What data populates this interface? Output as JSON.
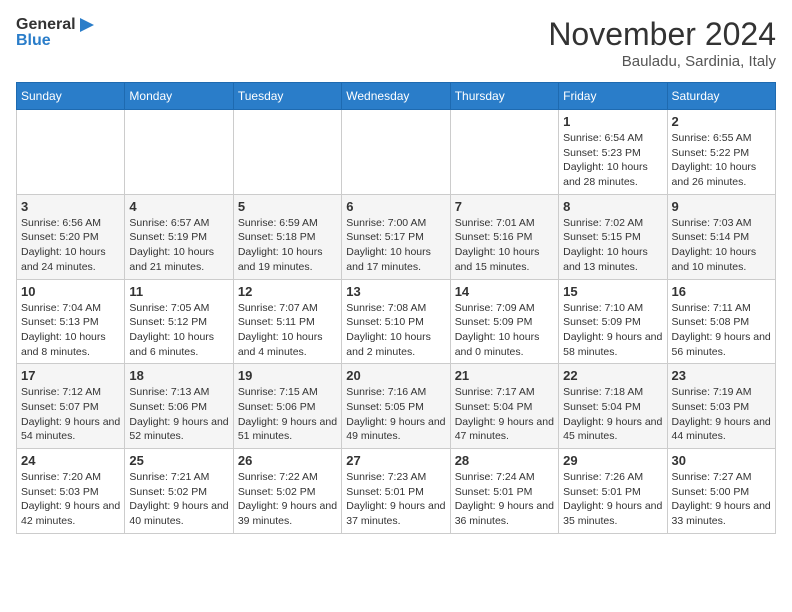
{
  "header": {
    "logo_general": "General",
    "logo_blue": "Blue",
    "month_title": "November 2024",
    "location": "Bauladu, Sardinia, Italy"
  },
  "weekdays": [
    "Sunday",
    "Monday",
    "Tuesday",
    "Wednesday",
    "Thursday",
    "Friday",
    "Saturday"
  ],
  "weeks": [
    [
      {
        "day": "",
        "info": ""
      },
      {
        "day": "",
        "info": ""
      },
      {
        "day": "",
        "info": ""
      },
      {
        "day": "",
        "info": ""
      },
      {
        "day": "",
        "info": ""
      },
      {
        "day": "1",
        "info": "Sunrise: 6:54 AM\nSunset: 5:23 PM\nDaylight: 10 hours and 28 minutes."
      },
      {
        "day": "2",
        "info": "Sunrise: 6:55 AM\nSunset: 5:22 PM\nDaylight: 10 hours and 26 minutes."
      }
    ],
    [
      {
        "day": "3",
        "info": "Sunrise: 6:56 AM\nSunset: 5:20 PM\nDaylight: 10 hours and 24 minutes."
      },
      {
        "day": "4",
        "info": "Sunrise: 6:57 AM\nSunset: 5:19 PM\nDaylight: 10 hours and 21 minutes."
      },
      {
        "day": "5",
        "info": "Sunrise: 6:59 AM\nSunset: 5:18 PM\nDaylight: 10 hours and 19 minutes."
      },
      {
        "day": "6",
        "info": "Sunrise: 7:00 AM\nSunset: 5:17 PM\nDaylight: 10 hours and 17 minutes."
      },
      {
        "day": "7",
        "info": "Sunrise: 7:01 AM\nSunset: 5:16 PM\nDaylight: 10 hours and 15 minutes."
      },
      {
        "day": "8",
        "info": "Sunrise: 7:02 AM\nSunset: 5:15 PM\nDaylight: 10 hours and 13 minutes."
      },
      {
        "day": "9",
        "info": "Sunrise: 7:03 AM\nSunset: 5:14 PM\nDaylight: 10 hours and 10 minutes."
      }
    ],
    [
      {
        "day": "10",
        "info": "Sunrise: 7:04 AM\nSunset: 5:13 PM\nDaylight: 10 hours and 8 minutes."
      },
      {
        "day": "11",
        "info": "Sunrise: 7:05 AM\nSunset: 5:12 PM\nDaylight: 10 hours and 6 minutes."
      },
      {
        "day": "12",
        "info": "Sunrise: 7:07 AM\nSunset: 5:11 PM\nDaylight: 10 hours and 4 minutes."
      },
      {
        "day": "13",
        "info": "Sunrise: 7:08 AM\nSunset: 5:10 PM\nDaylight: 10 hours and 2 minutes."
      },
      {
        "day": "14",
        "info": "Sunrise: 7:09 AM\nSunset: 5:09 PM\nDaylight: 10 hours and 0 minutes."
      },
      {
        "day": "15",
        "info": "Sunrise: 7:10 AM\nSunset: 5:09 PM\nDaylight: 9 hours and 58 minutes."
      },
      {
        "day": "16",
        "info": "Sunrise: 7:11 AM\nSunset: 5:08 PM\nDaylight: 9 hours and 56 minutes."
      }
    ],
    [
      {
        "day": "17",
        "info": "Sunrise: 7:12 AM\nSunset: 5:07 PM\nDaylight: 9 hours and 54 minutes."
      },
      {
        "day": "18",
        "info": "Sunrise: 7:13 AM\nSunset: 5:06 PM\nDaylight: 9 hours and 52 minutes."
      },
      {
        "day": "19",
        "info": "Sunrise: 7:15 AM\nSunset: 5:06 PM\nDaylight: 9 hours and 51 minutes."
      },
      {
        "day": "20",
        "info": "Sunrise: 7:16 AM\nSunset: 5:05 PM\nDaylight: 9 hours and 49 minutes."
      },
      {
        "day": "21",
        "info": "Sunrise: 7:17 AM\nSunset: 5:04 PM\nDaylight: 9 hours and 47 minutes."
      },
      {
        "day": "22",
        "info": "Sunrise: 7:18 AM\nSunset: 5:04 PM\nDaylight: 9 hours and 45 minutes."
      },
      {
        "day": "23",
        "info": "Sunrise: 7:19 AM\nSunset: 5:03 PM\nDaylight: 9 hours and 44 minutes."
      }
    ],
    [
      {
        "day": "24",
        "info": "Sunrise: 7:20 AM\nSunset: 5:03 PM\nDaylight: 9 hours and 42 minutes."
      },
      {
        "day": "25",
        "info": "Sunrise: 7:21 AM\nSunset: 5:02 PM\nDaylight: 9 hours and 40 minutes."
      },
      {
        "day": "26",
        "info": "Sunrise: 7:22 AM\nSunset: 5:02 PM\nDaylight: 9 hours and 39 minutes."
      },
      {
        "day": "27",
        "info": "Sunrise: 7:23 AM\nSunset: 5:01 PM\nDaylight: 9 hours and 37 minutes."
      },
      {
        "day": "28",
        "info": "Sunrise: 7:24 AM\nSunset: 5:01 PM\nDaylight: 9 hours and 36 minutes."
      },
      {
        "day": "29",
        "info": "Sunrise: 7:26 AM\nSunset: 5:01 PM\nDaylight: 9 hours and 35 minutes."
      },
      {
        "day": "30",
        "info": "Sunrise: 7:27 AM\nSunset: 5:00 PM\nDaylight: 9 hours and 33 minutes."
      }
    ]
  ]
}
